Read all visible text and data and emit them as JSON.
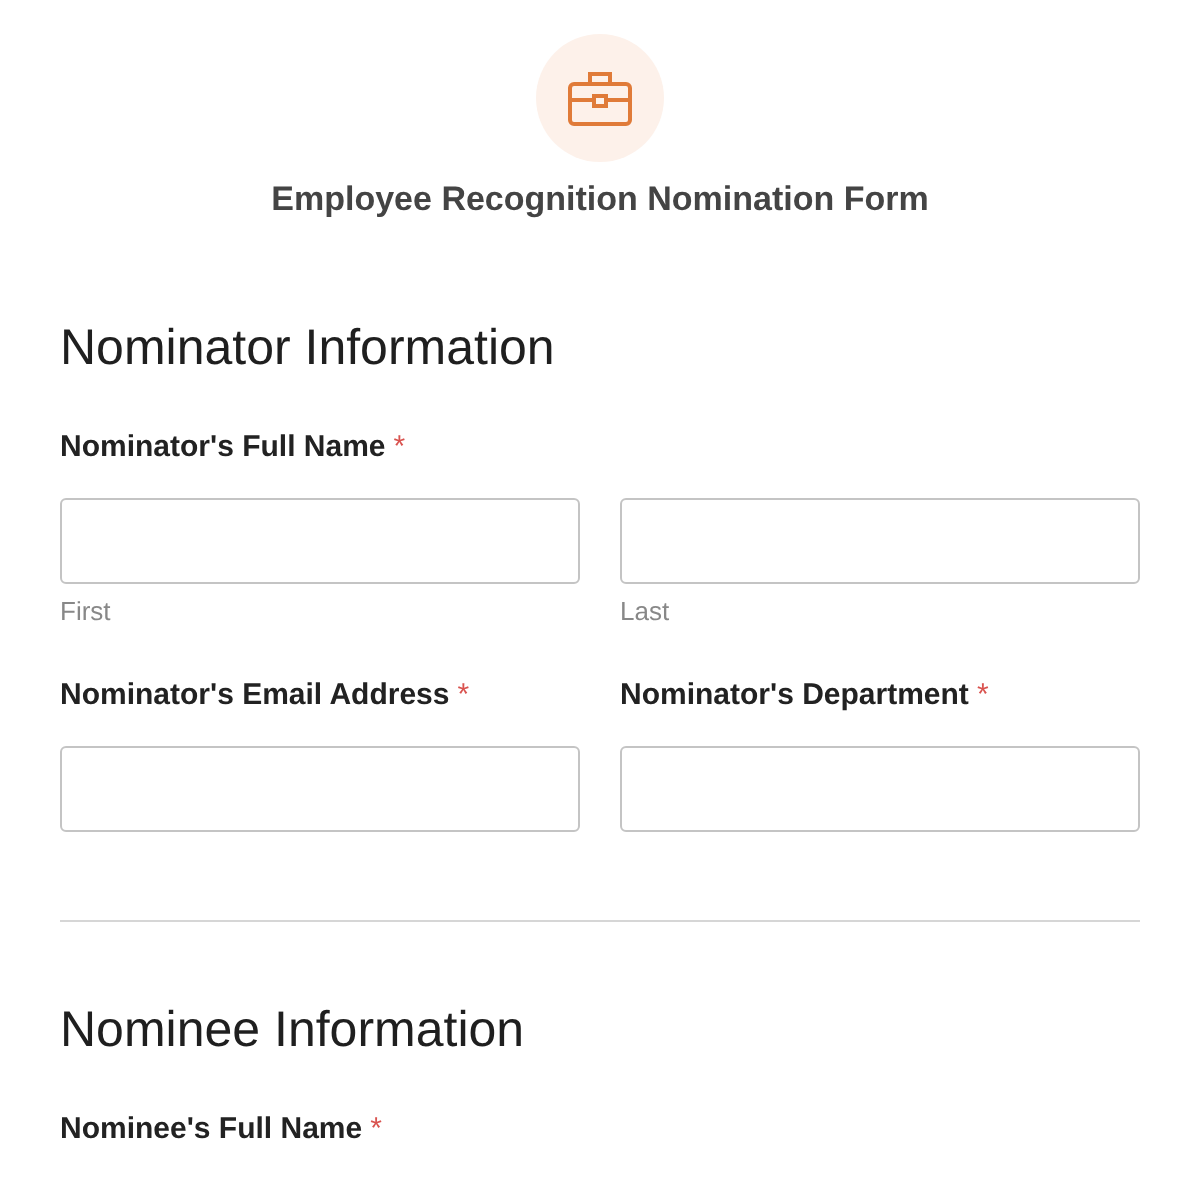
{
  "header": {
    "title": "Employee Recognition Nomination Form"
  },
  "sections": [
    {
      "title": "Nominator Information",
      "rows": [
        [
          {
            "label": "Nominator's Full Name",
            "required_mark": "*",
            "kind": "name",
            "sublabels": [
              "First",
              "Last"
            ]
          }
        ],
        [
          {
            "label": "Nominator's Email Address",
            "required_mark": "*",
            "kind": "text"
          },
          {
            "label": "Nominator's Department",
            "required_mark": "*",
            "kind": "text"
          }
        ]
      ]
    },
    {
      "title": "Nominee Information",
      "rows": [
        [
          {
            "label": "Nominee's Full Name",
            "required_mark": "*"
          }
        ]
      ]
    }
  ]
}
